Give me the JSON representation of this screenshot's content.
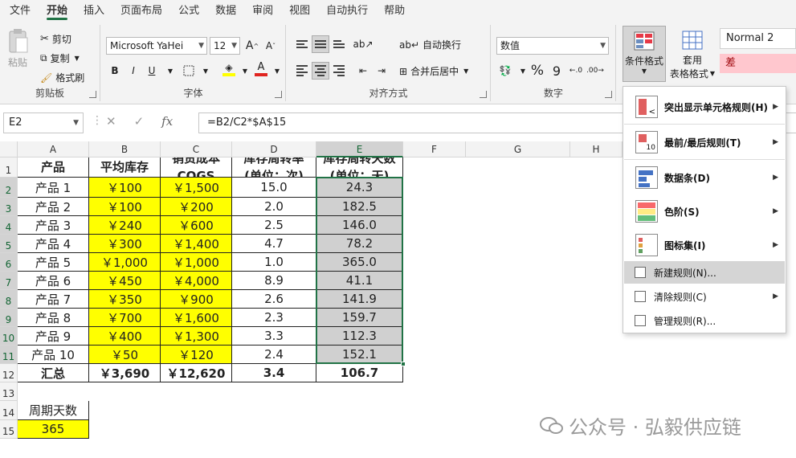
{
  "tabs": [
    "文件",
    "开始",
    "插入",
    "页面布局",
    "公式",
    "数据",
    "审阅",
    "视图",
    "自动执行",
    "帮助"
  ],
  "ribbon": {
    "clipboard": {
      "paste": "粘贴",
      "cut": "剪切",
      "copy": "复制",
      "format_painter": "格式刷",
      "label": "剪贴板"
    },
    "font": {
      "name": "Microsoft YaHei",
      "size": "12",
      "bold": "B",
      "italic": "I",
      "underline": "U",
      "label": "字体"
    },
    "alignment": {
      "wrap": "自动换行",
      "merge": "合并后居中",
      "label": "对齐方式"
    },
    "number": {
      "format": "数值",
      "percent": "%",
      "comma": "9",
      "label": "数字"
    },
    "styles": {
      "conditional": "条件格式",
      "table_line1": "套用",
      "table_line2": "表格格式",
      "normal": "Normal 2",
      "bad": "差"
    }
  },
  "formula_bar": {
    "name_box": "E2",
    "formula": "=B2/C2*$A$15",
    "fx": "fx"
  },
  "columns": [
    "A",
    "B",
    "C",
    "D",
    "E",
    "F",
    "G",
    "H"
  ],
  "rows": [
    "1",
    "2",
    "3",
    "4",
    "5",
    "6",
    "7",
    "8",
    "9",
    "10",
    "11",
    "12",
    "13",
    "14",
    "15"
  ],
  "table": {
    "headers": [
      {
        "line1": "产品",
        "line2": ""
      },
      {
        "line1": "平均库存",
        "line2": ""
      },
      {
        "line1": "销货成本",
        "line2": "COGS"
      },
      {
        "line1": "库存周转率",
        "line2": "(单位：次)"
      },
      {
        "line1": "库存周转天数",
        "line2": "(单位：天)"
      }
    ],
    "rows": [
      [
        "产品 1",
        "￥100",
        "￥1,500",
        "15.0",
        "24.3"
      ],
      [
        "产品 2",
        "￥100",
        "￥200",
        "2.0",
        "182.5"
      ],
      [
        "产品 3",
        "￥240",
        "￥600",
        "2.5",
        "146.0"
      ],
      [
        "产品 4",
        "￥300",
        "￥1,400",
        "4.7",
        "78.2"
      ],
      [
        "产品 5",
        "￥1,000",
        "￥1,000",
        "1.0",
        "365.0"
      ],
      [
        "产品 6",
        "￥450",
        "￥4,000",
        "8.9",
        "41.1"
      ],
      [
        "产品 7",
        "￥350",
        "￥900",
        "2.6",
        "141.9"
      ],
      [
        "产品 8",
        "￥700",
        "￥1,600",
        "2.3",
        "159.7"
      ],
      [
        "产品 9",
        "￥400",
        "￥1,300",
        "3.3",
        "112.3"
      ],
      [
        "产品 10",
        "￥50",
        "￥120",
        "2.4",
        "152.1"
      ]
    ],
    "total": [
      "汇总",
      "￥3,690",
      "￥12,620",
      "3.4",
      "106.7"
    ]
  },
  "period": {
    "label": "周期天数",
    "value": "365"
  },
  "menu": {
    "items": [
      "突出显示单元格规则(H)",
      "最前/最后规则(T)",
      "数据条(D)",
      "色阶(S)",
      "图标集(I)",
      "新建规则(N)...",
      "清除规则(C)",
      "管理规则(R)..."
    ]
  },
  "watermark": "公众号 · 弘毅供应链",
  "colors": {
    "accent": "#217346",
    "highlight_yellow": "#ffff00",
    "grey_fill": "#d0d0d0",
    "bad_fill": "#ffc7ce"
  }
}
